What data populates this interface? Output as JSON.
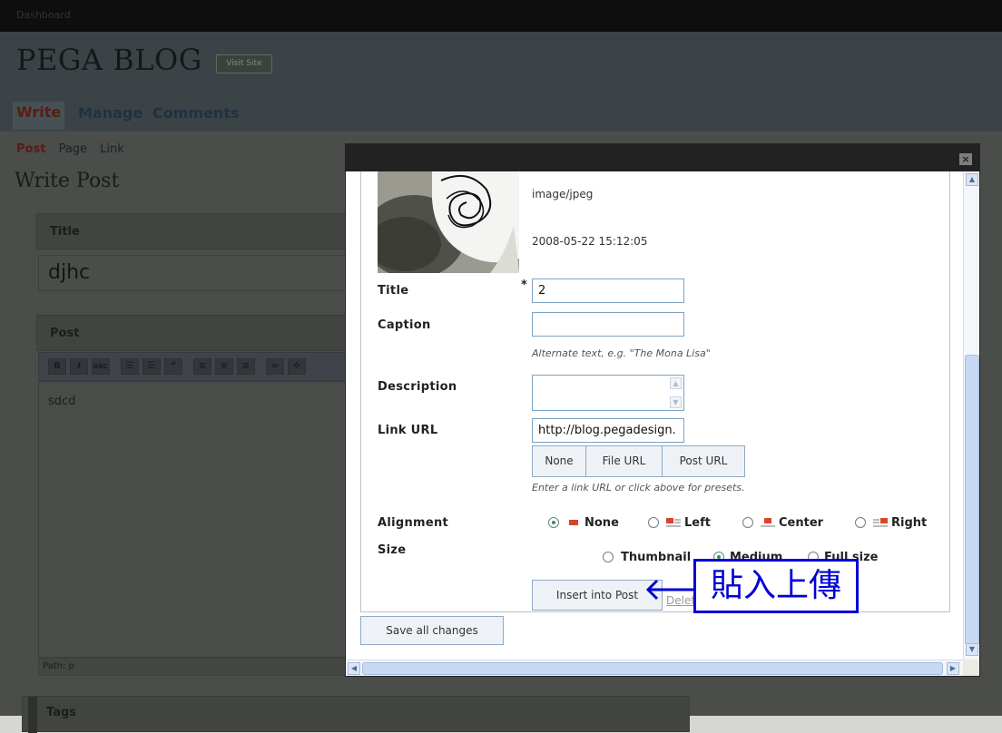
{
  "admin": {
    "top_bar": "Dashboard",
    "blog_title": "PEGA BLOG",
    "visit_site": "Visit Site",
    "tabs": [
      {
        "label": "Write",
        "active": true
      },
      {
        "label": "Manage",
        "active": false
      },
      {
        "label": "Comments",
        "active": false
      }
    ],
    "subnav": {
      "post": "Post",
      "page": "Page",
      "link": "Link"
    },
    "heading": "Write Post",
    "title_label": "Title",
    "title_value": "djhc",
    "post_label": "Post",
    "editor_text": "sdcd",
    "path": "Path: p",
    "tags_label": "Tags"
  },
  "modal": {
    "mime": "image/jpeg",
    "date": "2008-05-22 15:12:05",
    "fields": {
      "title_label": "Title",
      "required_mark": "*",
      "title_value": "2",
      "caption_label": "Caption",
      "caption_value": "",
      "caption_hint": "Alternate text, e.g. \"The Mona Lisa\"",
      "description_label": "Description",
      "link_url_label": "Link URL",
      "link_url_value": "http://blog.pegadesign.",
      "link_buttons": [
        "None",
        "File URL",
        "Post URL"
      ],
      "link_hint": "Enter a link URL or click above for presets.",
      "alignment_label": "Alignment",
      "alignment_options": [
        "None",
        "Left",
        "Center",
        "Right"
      ],
      "alignment_selected": "None",
      "size_label": "Size",
      "size_options": [
        "Thumbnail",
        "Medium",
        "Full size"
      ],
      "size_selected": "Medium"
    },
    "insert_button": "Insert into Post",
    "delete_link": "Delete",
    "save_button": "Save all changes",
    "close": "×"
  },
  "annotation": {
    "text": "貼入上傳",
    "color": "#0000d8"
  }
}
